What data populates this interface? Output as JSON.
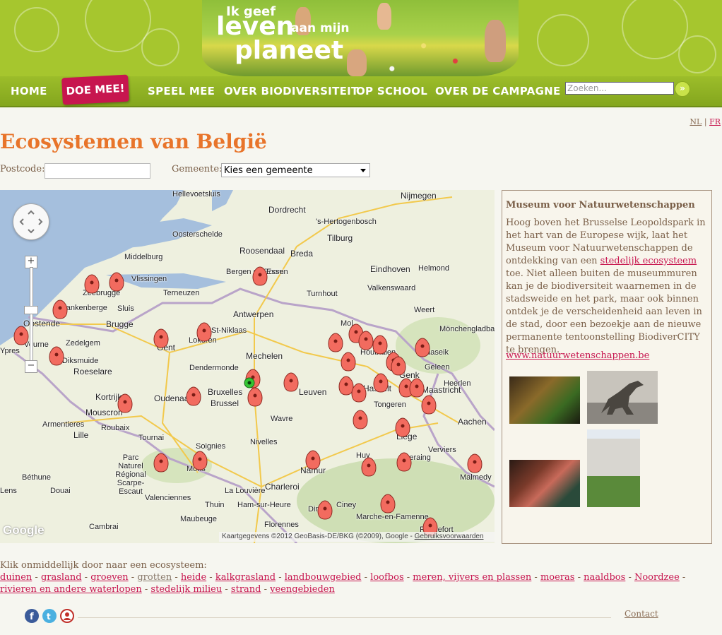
{
  "header": {
    "logo_line1": "Ik geef",
    "logo_line2": "leven",
    "logo_line3": "aan mijn",
    "logo_line4": "planeet"
  },
  "nav": {
    "items": [
      "HOME",
      "DOE MEE!",
      "SPEEL MEE",
      "OVER BIODIVERSITEIT",
      "OP SCHOOL",
      "OVER DE CAMPAGNE"
    ],
    "search_placeholder": "Zoeken...",
    "search_button_icon": "double-chevron-right-icon"
  },
  "lang": {
    "nl": "NL",
    "sep": "|",
    "fr": "FR"
  },
  "page_title": "Ecosystemen van België",
  "form": {
    "postcode_label": "Postcode:",
    "postcode_value": "",
    "gemeente_label": "Gemeente:",
    "gemeente_selected": "Kies een gemeente"
  },
  "map": {
    "labels": [
      "Hellevoetsluis",
      "Nijmegen",
      "Dordrecht",
      "'s-Hertogenbosch",
      "Oosterschelde",
      "Tilburg",
      "Middelburg",
      "Roosendaal",
      "Breda",
      "Bergen op Zoom",
      "Essen",
      "Eindhoven",
      "Helmond",
      "Vlissingen",
      "Zeebrugge",
      "Terneuzen",
      "Turnhout",
      "Valkenswaard",
      "Blankenberge",
      "Sluis",
      "Antwerpen",
      "Weert",
      "Oostende",
      "Brugge",
      "St-Niklaas",
      "Mol",
      "Mönchengladbach",
      "Veurne",
      "Gent",
      "Lokeren",
      "Houthalen",
      "Maaseik",
      "Diksmuide",
      "Zedelgem",
      "Dendermonde",
      "Mechelen",
      "Genk",
      "Geleen",
      "Roeselare",
      "Heerlen",
      "Kortrijk",
      "Oudenaarde",
      "Bruxelles",
      "Brussel",
      "Leuven",
      "Hasselt",
      "Maastricht",
      "Tongeren",
      "Mouscron",
      "Armentieres",
      "Roubaix",
      "Wavre",
      "Aachen",
      "Lille",
      "Tournai",
      "Liège",
      "Soignies",
      "Nivelles",
      "Verviers",
      "Parc Naturel Régional Scarpe-Escaut",
      "Mons",
      "Huy",
      "Seraing",
      "Lens",
      "Béthune",
      "Douai",
      "Charleroi",
      "La Louvière",
      "Namur",
      "Malmedy",
      "Valenciennes",
      "Thuin",
      "Ham-sur-Heure",
      "Ciney",
      "Dinant",
      "Marche-en-Famenne",
      "Cambrai",
      "Maubeuge",
      "Florennes",
      "Rochefort",
      "Ypres"
    ],
    "google_logo": "Google",
    "attribution": "Kaartgegevens ©2012 GeoBasis-DE/BKG (©2009), Google -",
    "attribution_link": "Gebruiksvoorwaarden",
    "zoom_in": "+",
    "zoom_out": "−",
    "zoom_out2": "−"
  },
  "sidebox": {
    "title": "Museum voor Natuurwetenschappen",
    "text_before": "Hoog boven het Brusselse Leopoldspark in het hart van de Europese wijk, laat het Museum voor Natuurwetenschappen de ontdekking van een ",
    "text_link": "stedelijk ecosysteem",
    "text_after": " toe. Niet alleen buiten de museummuren kan je de biodiversiteit waarnemen in de stadsweide en het park, maar ook binnen ontdek je de verscheidenheid aan leven in de stad, door een bezoekje aan de nieuwe permanente tentoonstelling BiodiverCITY te brengen.",
    "url": "www.natuurwetenschappen.be"
  },
  "footer": {
    "title": "Klik onmiddellijk door naar een ecosysteem:",
    "links": [
      "duinen",
      "grasland",
      "groeven",
      "grotten",
      "heide",
      "kalkgrasland",
      "landbouwgebied",
      "loofbos",
      "meren, vijvers en plassen",
      "moeras",
      "naaldbos",
      "Noordzee",
      "rivieren en andere waterlopen",
      "stedelijk milieu",
      "strand",
      "veengebieden"
    ],
    "contact": "Contact",
    "social": [
      "facebook-icon",
      "twitter-icon",
      "profile-icon"
    ]
  },
  "colors": {
    "header_green": "#a6c62e",
    "accent_pink": "#c7164f",
    "title_orange": "#e8742a"
  }
}
